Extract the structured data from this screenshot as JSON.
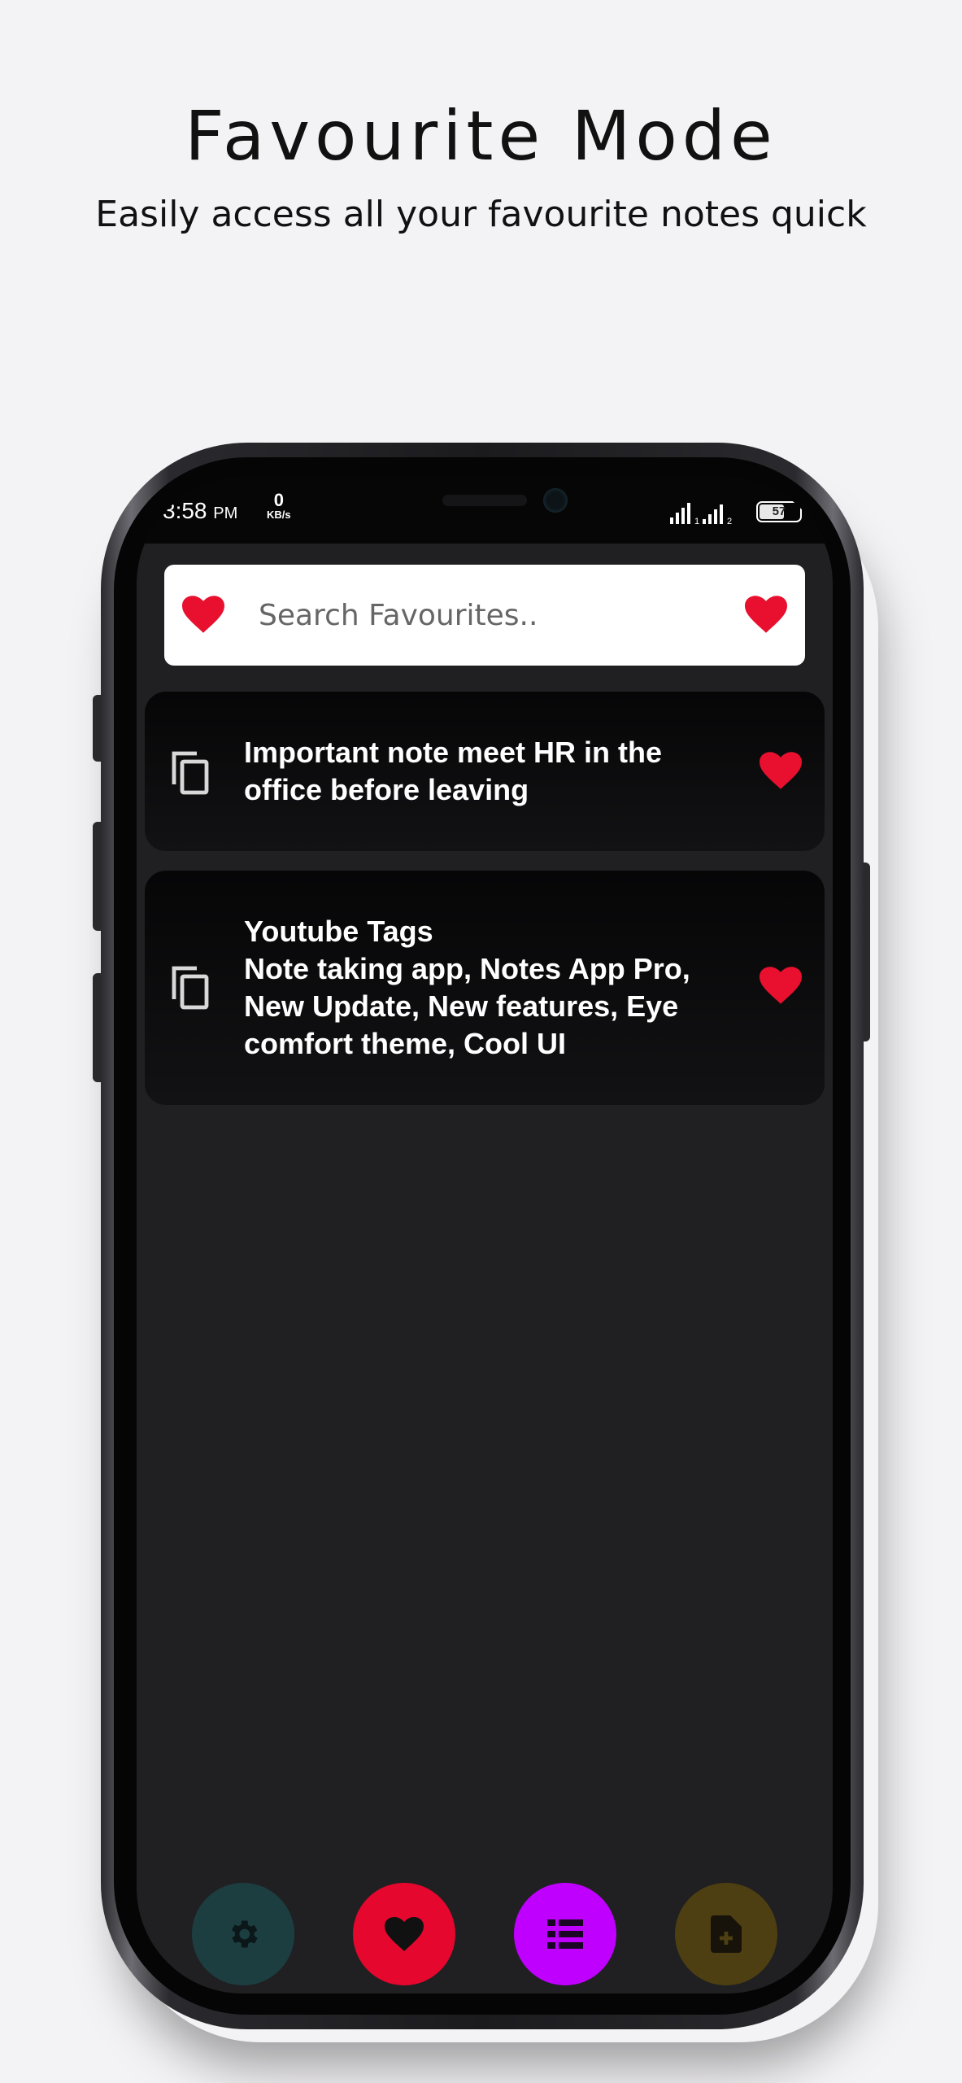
{
  "hero": {
    "title": "Favourite Mode",
    "subtitle": "Easily access all your favourite notes quick"
  },
  "status_bar": {
    "time": "3:58",
    "ampm": "PM",
    "net_value": "0",
    "net_unit": "KB/s",
    "sim1": "1",
    "sim2": "2",
    "battery": "57"
  },
  "search": {
    "placeholder": "Search Favourites.."
  },
  "notes": [
    {
      "text": "Important note meet HR in the\noffice before leaving",
      "favourite": true
    },
    {
      "title": "Youtube Tags",
      "text": "Note taking app, Notes App Pro,\nNew Update, New features, Eye\ncomfort theme, Cool UI",
      "favourite": true
    }
  ],
  "bottom_nav": [
    {
      "icon": "gear-icon",
      "color": "#1c3e41"
    },
    {
      "icon": "heart-icon",
      "color": "#e5072d"
    },
    {
      "icon": "list-icon",
      "color": "#c000ff"
    },
    {
      "icon": "add-note-icon",
      "color": "#4d3f12"
    }
  ],
  "colors": {
    "accent_red": "#e8102e",
    "screen_bg": "#202022"
  }
}
